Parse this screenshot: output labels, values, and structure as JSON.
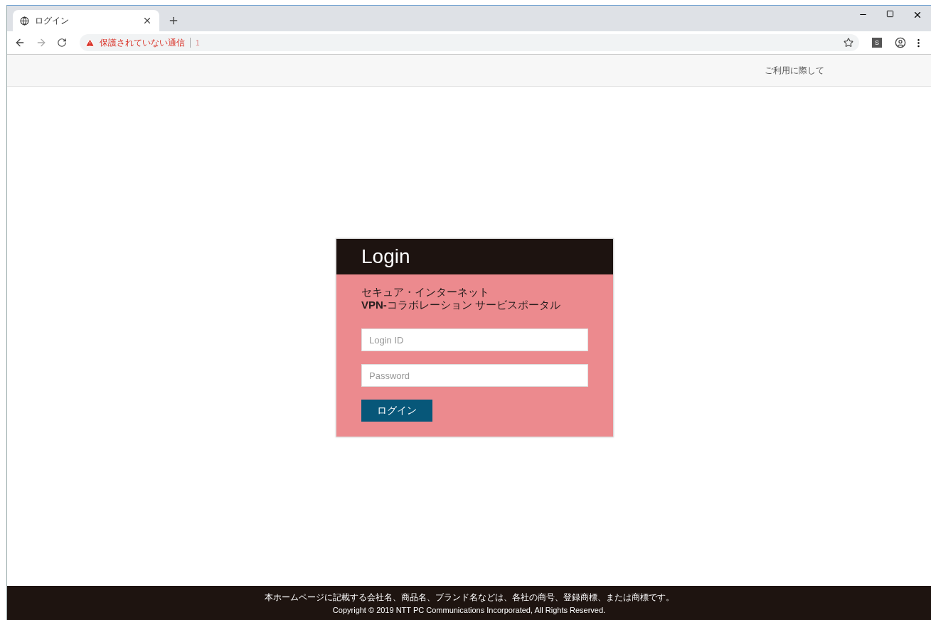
{
  "browser": {
    "tab": {
      "title": "ログイン",
      "selected": true
    },
    "address": {
      "warning": "保護されていない通信",
      "url": "1"
    },
    "extension": "S"
  },
  "header": {
    "link": "ご利用に際して"
  },
  "login": {
    "title": "Login",
    "subtitle_lines": [
      "セキュア・インターネット",
      "**VPN-**コラボレーション サービスポータル"
    ],
    "fields": [
      {
        "placeholder": "Login ID"
      },
      {
        "placeholder": "Password"
      }
    ],
    "button": "ログイン"
  },
  "footer": {
    "lines": [
      "本ホームページに記載する会社名、商品名、ブランド名などは、各社の商号、登録商標、または商標です。",
      "Copyright © 2019 NTT PC Communications Incorporated, All Rights Reserved."
    ]
  }
}
